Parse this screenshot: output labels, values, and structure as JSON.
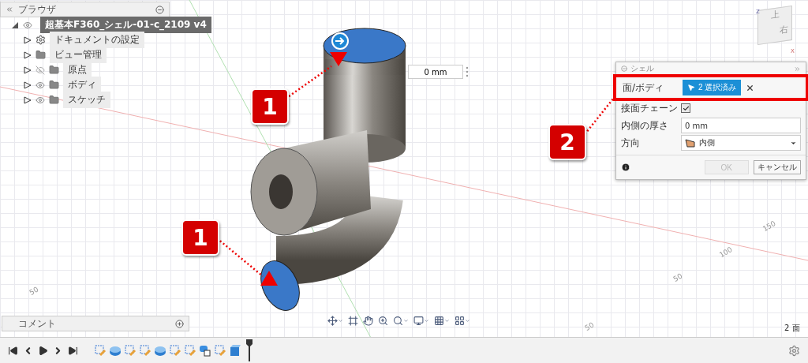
{
  "browser": {
    "title": "ブラウザ",
    "root": {
      "label": "超基本F360_シェル-01-c_2109 v4",
      "active": true,
      "visible": true
    },
    "items": [
      {
        "label": "ドキュメントの設定",
        "kind": "settings"
      },
      {
        "label": "ビュー管理",
        "kind": "folder"
      },
      {
        "label": "原点",
        "kind": "folder",
        "visible": false
      },
      {
        "label": "ボディ",
        "kind": "folder",
        "visible": true
      },
      {
        "label": "スケッチ",
        "kind": "folder",
        "visible": true
      }
    ]
  },
  "dimension_field": {
    "value": "0 mm"
  },
  "callouts": [
    "1",
    "1",
    "2"
  ],
  "viewcube": {
    "top": "上",
    "right": "右",
    "axis_z": "Z",
    "axis_x": "X"
  },
  "dialog": {
    "title": "シェル",
    "rows": [
      {
        "kind": "selection",
        "label": "面/ボディ",
        "value": "2 選択済み",
        "highlighted": true
      },
      {
        "kind": "checkbox",
        "label": "接面チェーン",
        "checked": true
      },
      {
        "kind": "input",
        "label": "内側の厚さ",
        "value": "0 mm"
      },
      {
        "kind": "dropdown",
        "label": "方向",
        "value": "内側"
      }
    ],
    "buttons": [
      {
        "label": "OK",
        "disabled": true
      },
      {
        "label": "キャンセル",
        "disabled": false
      }
    ]
  },
  "grid_labels": [
    "150",
    "100",
    "50",
    "50",
    "50"
  ],
  "comments": {
    "title": "コメント"
  },
  "status": "2 面",
  "timeline": [
    {
      "kind": "sketch"
    },
    {
      "kind": "body"
    },
    {
      "kind": "sketch"
    },
    {
      "kind": "sketch"
    },
    {
      "kind": "body"
    },
    {
      "kind": "sketch"
    },
    {
      "kind": "sketch"
    },
    {
      "kind": "combine"
    },
    {
      "kind": "sketch"
    },
    {
      "kind": "solid"
    }
  ]
}
